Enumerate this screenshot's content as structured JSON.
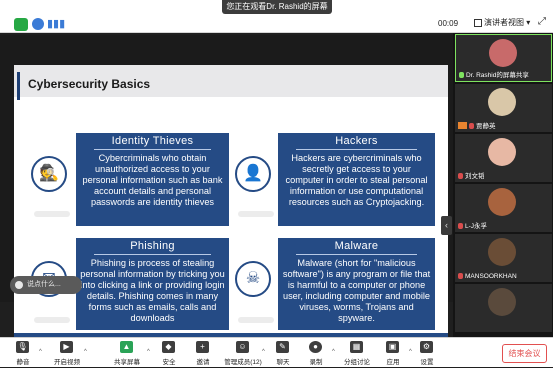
{
  "topbar": {
    "viewing_label": "您正在观看Dr. Rashid的屏幕",
    "timer": "00:09",
    "view_label": "演讲者视图"
  },
  "slide": {
    "title": "Cybersecurity Basics",
    "cards": [
      {
        "title": "Identity Thieves",
        "body": "Cybercriminals who obtain unauthorized access to your personal information such as bank account details and personal passwords are identity thieves"
      },
      {
        "title": "Hackers",
        "body": "Hackers are cybercriminals who secretly get access to your computer in order to steal personal information or use computational resources such as Cryptojacking."
      },
      {
        "title": "Phishing",
        "body": "Phishing is process of stealing personal information by tricking you into clicking a link or providing login details. Phishing comes in many forms such as emails, calls and downloads"
      },
      {
        "title": "Malware",
        "body": "Malware (short for \"malicious software\") is any program or file that is harmful to a computer or phone user, including computer and mobile viruses, worms, Trojans and spyware."
      }
    ]
  },
  "comment_placeholder": "说点什么...",
  "participants": [
    {
      "name": "Dr. Rashid的屏幕共享",
      "color": "#c86a6a"
    },
    {
      "name": "贾静英",
      "color": "#d9c7a8"
    },
    {
      "name": "刘文韬",
      "color": "#e7b8a4"
    },
    {
      "name": "L-J永孚",
      "color": "#a8633e"
    },
    {
      "name": "MANSOORKHAN",
      "color": "#6a4d36"
    },
    {
      "name": "",
      "color": "#5a4a3c"
    }
  ],
  "toolbar": {
    "items": [
      {
        "label": "静音",
        "icon": "microphone-icon"
      },
      {
        "label": "开启视频",
        "icon": "camera-icon"
      },
      {
        "label": "共享屏幕",
        "icon": "share-screen-icon"
      },
      {
        "label": "安全",
        "icon": "shield-icon"
      },
      {
        "label": "邀请",
        "icon": "invite-icon"
      },
      {
        "label": "管理成员(12)",
        "icon": "participants-icon"
      },
      {
        "label": "聊天",
        "icon": "chat-icon"
      },
      {
        "label": "录制",
        "icon": "record-icon"
      },
      {
        "label": "分组讨论",
        "icon": "breakout-icon"
      },
      {
        "label": "应用",
        "icon": "apps-icon"
      },
      {
        "label": "设置",
        "icon": "settings-icon"
      }
    ],
    "end_label": "结束会议"
  }
}
